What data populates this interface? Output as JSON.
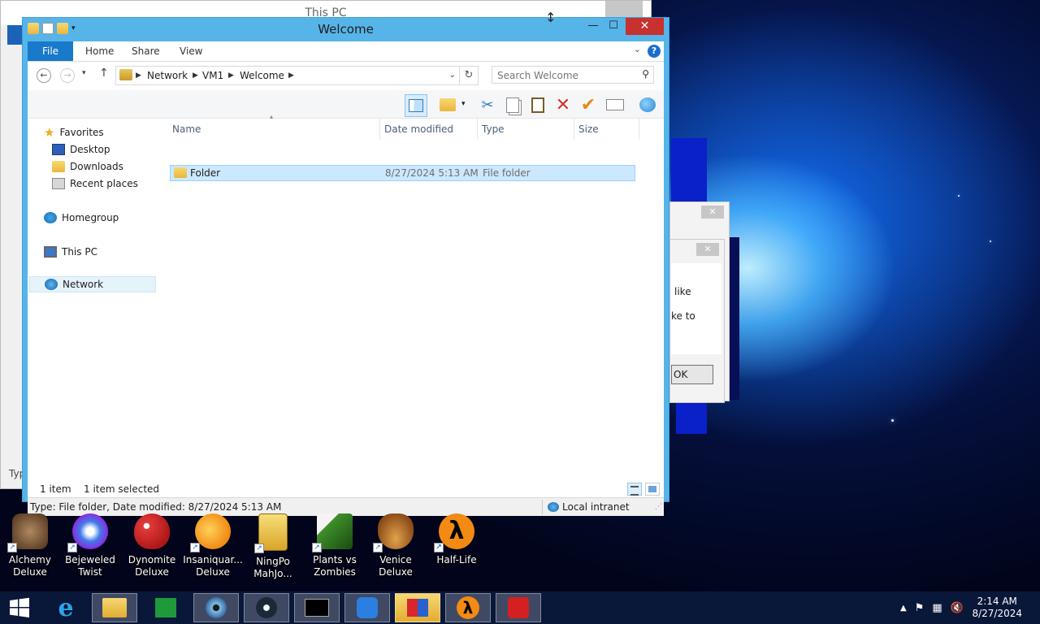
{
  "background_window": {
    "title": "This PC",
    "status_fragment": "Typ"
  },
  "dialog": {
    "text_line1": "like",
    "text_line2": "ke to",
    "ok_label": "OK",
    "close_glyph": "✕"
  },
  "window": {
    "title": "Welcome",
    "minimize_glyph": "—",
    "maximize_glyph": "☐",
    "close_glyph": "✕",
    "accent": "#1979ca"
  },
  "ribbon": {
    "tabs": [
      "File",
      "Home",
      "Share",
      "View"
    ],
    "expand_glyph": "⌄",
    "help_glyph": "?"
  },
  "address": {
    "crumbs": [
      "Network",
      "VM1",
      "Welcome"
    ],
    "search_placeholder": "Search Welcome"
  },
  "nav_pane": {
    "favorites": "Favorites",
    "desktop": "Desktop",
    "downloads": "Downloads",
    "recent": "Recent places",
    "homegroup": "Homegroup",
    "this_pc": "This PC",
    "network": "Network"
  },
  "columns": {
    "name": "Name",
    "date": "Date modified",
    "type": "Type",
    "size": "Size"
  },
  "files": [
    {
      "name": "Folder",
      "date": "8/27/2024 5:13 AM",
      "type": "File folder",
      "size": ""
    }
  ],
  "status": {
    "count": "1 item",
    "selected": "1 item selected"
  },
  "details": {
    "info": "Type: File folder, Date modified: 8/27/2024 5:13 AM",
    "zone": "Local intranet"
  },
  "desktop_icons": [
    {
      "l1": "Alchemy",
      "l2": "Deluxe",
      "color": "#6b4a2a"
    },
    {
      "l1": "Bejeweled",
      "l2": "Twist",
      "color": "#8a2be2"
    },
    {
      "l1": "Dynomite",
      "l2": "Deluxe",
      "color": "#d9262c"
    },
    {
      "l1": "Insaniquar...",
      "l2": "Deluxe",
      "color": "#f39a1d"
    },
    {
      "l1": "NingPo",
      "l2": "MahJo...",
      "color": "#e9b72a"
    },
    {
      "l1": "Plants vs",
      "l2": "Zombies",
      "color": "#3f8f2a"
    },
    {
      "l1": "Venice",
      "l2": "Deluxe",
      "color": "#c27a2e"
    },
    {
      "l1": "Half-Life",
      "l2": "",
      "color": "#f28a13"
    }
  ],
  "clock": {
    "time": "2:14 AM",
    "date": "8/27/2024"
  }
}
